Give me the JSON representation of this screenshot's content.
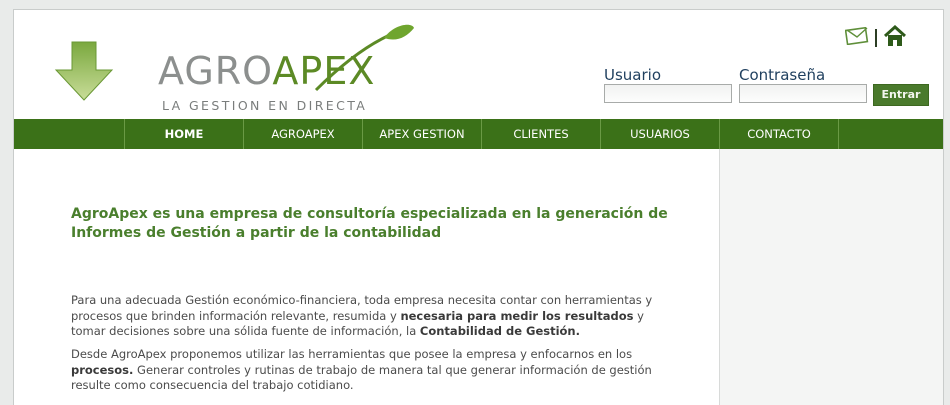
{
  "brand": {
    "name_part1": "AGRO",
    "name_part2": "APEX",
    "tagline": "LA GESTION EN DIRECTA",
    "colors": {
      "green": "#3b7118",
      "light_green": "#5c8a25",
      "gray": "#8c8f8e"
    }
  },
  "top_icons": [
    "mail-icon",
    "home-icon"
  ],
  "login": {
    "user_label": "Usuario",
    "password_label": "Contraseña",
    "user_value": "",
    "password_value": "",
    "submit_label": "Entrar"
  },
  "nav": {
    "items": [
      {
        "label": "HOME"
      },
      {
        "label": "AGROAPEX"
      },
      {
        "label": "APEX GESTION"
      },
      {
        "label": "CLIENTES"
      },
      {
        "label": "USUARIOS"
      },
      {
        "label": "CONTACTO"
      }
    ]
  },
  "content": {
    "headline": " AgroApex es una empresa de consultoría especializada en la generación de Informes de Gestión a partir de la contabilidad",
    "p1": {
      "a": "Para una adecuada Gestión económico-financiera, toda empresa necesita contar con herramientas y procesos que brinden información relevante, resumida y ",
      "b": "necesaria para medir los resultados",
      "c": " y tomar decisiones sobre una sólida fuente de información, la ",
      "d": "Contabilidad de Gestión."
    },
    "p2": {
      "a": "Desde AgroApex proponemos utilizar las herramientas que posee la empresa y enfocarnos en los ",
      "b": "procesos.",
      "c": " Generar controles y rutinas de trabajo de manera tal que generar información de gestión resulte como consecuencia del trabajo cotidiano."
    }
  }
}
